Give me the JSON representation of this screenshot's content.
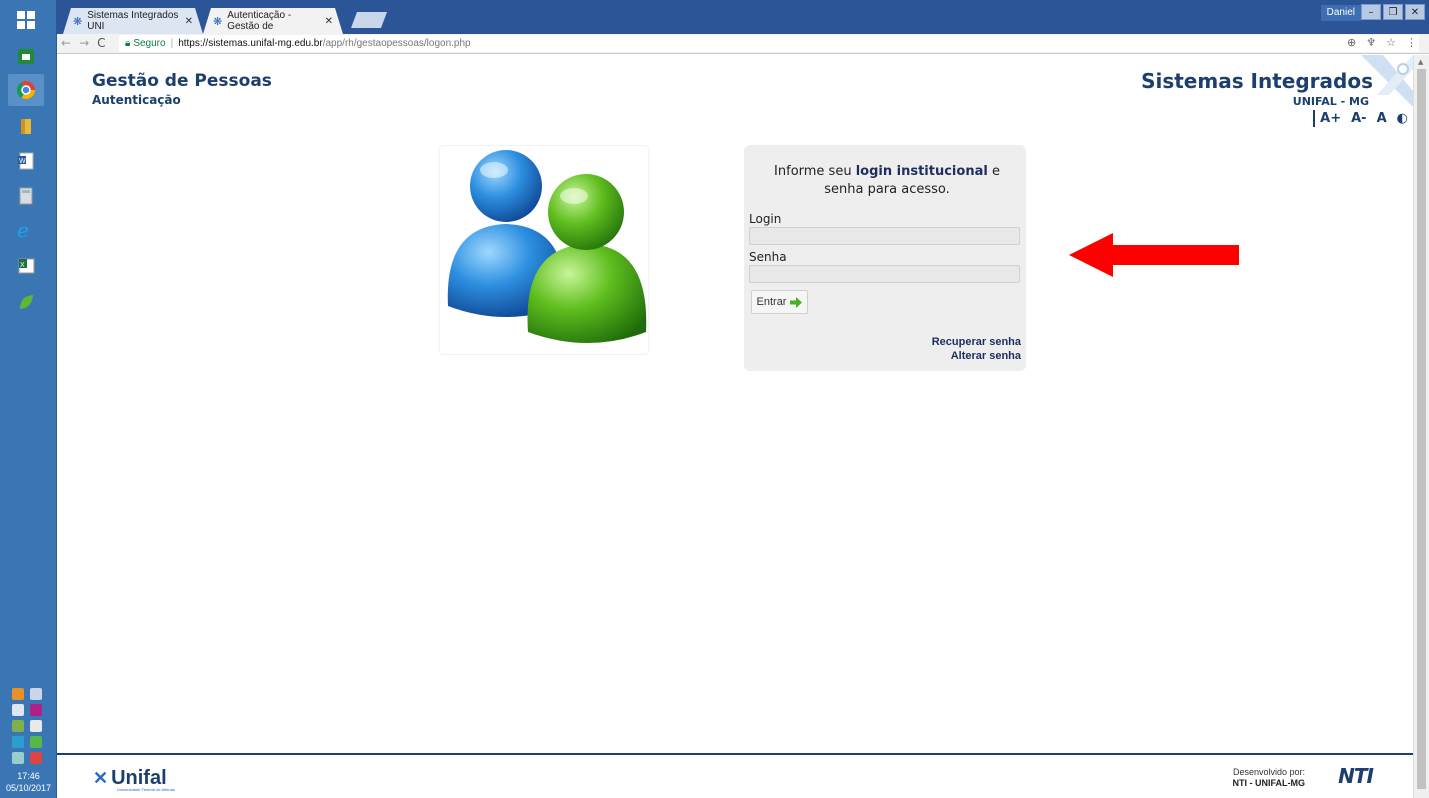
{
  "taskbar": {
    "clock_time": "17:46",
    "clock_date": "05/10/2017"
  },
  "browser": {
    "tabs": [
      {
        "label": "Sistemas Integrados UNI",
        "active": false
      },
      {
        "label": "Autenticação - Gestão de",
        "active": true
      }
    ],
    "user_label": "Daniel",
    "address": {
      "secure_label": "Seguro",
      "host": "https://sistemas.unifal-mg.edu.br",
      "path": "/app/rh/gestaopessoas/logon.php"
    }
  },
  "header": {
    "title": "Gestão de Pessoas",
    "subtitle": "Autenticação",
    "brand": "Sistemas Integrados",
    "brand_sub": "UNIFAL - MG",
    "a11y": {
      "increase": "A+",
      "decrease": "A-",
      "reset": "A",
      "contrast": "◐"
    }
  },
  "login": {
    "message_pre": "Informe seu ",
    "message_bold": "login institucional",
    "message_post": " e senha para acesso.",
    "login_label": "Login",
    "login_value": "",
    "password_label": "Senha",
    "password_value": "",
    "submit_label": "Entrar",
    "recover_link": "Recuperar senha",
    "change_link": "Alterar senha"
  },
  "footer": {
    "logo_text": "Unifal",
    "logo_tagline": "Universidade Federal de Alfenas",
    "developed_by": "Desenvolvido por:",
    "developer": "NTI - UNIFAL-MG",
    "developer_logo": "NTI"
  },
  "colors": {
    "brand_navy": "#1d3f6e",
    "taskbar_blue": "#3b76b4",
    "arrow_red": "#ff0000",
    "login_bg": "#eeeeee"
  }
}
